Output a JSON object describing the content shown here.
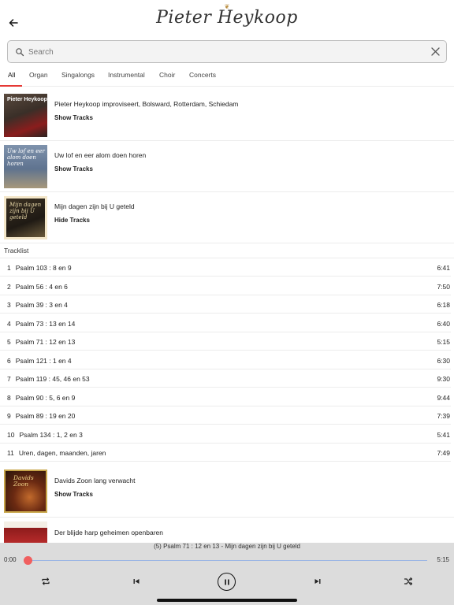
{
  "header": {
    "logo_text": "Pieter Heykoop",
    "back_icon": "arrow-left-icon"
  },
  "search": {
    "placeholder": "Search",
    "value": ""
  },
  "tabs": [
    {
      "label": "All",
      "active": true
    },
    {
      "label": "Organ",
      "active": false
    },
    {
      "label": "Singalongs",
      "active": false
    },
    {
      "label": "Instrumental",
      "active": false
    },
    {
      "label": "Choir",
      "active": false
    },
    {
      "label": "Concerts",
      "active": false
    }
  ],
  "albums": [
    {
      "title": "Pieter Heykoop improviseert, Bolsward, Rotterdam, Schiedam",
      "action": "Show Tracks",
      "cover_text": "Pieter Heykoop"
    },
    {
      "title": "Uw lof en eer alom doen horen",
      "action": "Show Tracks",
      "cover_text": "Uw lof en eer alom doen horen"
    },
    {
      "title": "Mijn dagen zijn bij U geteld",
      "action": "Hide Tracks",
      "cover_text": "Mijn dagen zijn bij U geteld"
    },
    {
      "title": "Davids Zoon lang verwacht",
      "action": "Show Tracks",
      "cover_text": "Davids Zoon"
    },
    {
      "title": "Der blijde harp geheimen openbaren",
      "action": "",
      "cover_text": ""
    }
  ],
  "tracklist": {
    "heading": "Tracklist",
    "tracks": [
      {
        "num": "1",
        "title": "Psalm 103 : 8 en 9",
        "duration": "6:41"
      },
      {
        "num": "2",
        "title": "Psalm 56 : 4 en 6",
        "duration": "7:50"
      },
      {
        "num": "3",
        "title": "Psalm 39 : 3 en 4",
        "duration": "6:18"
      },
      {
        "num": "4",
        "title": "Psalm 73 : 13 en 14",
        "duration": "6:40"
      },
      {
        "num": "5",
        "title": "Psalm 71 : 12 en 13",
        "duration": "5:15"
      },
      {
        "num": "6",
        "title": "Psalm 121 : 1 en 4",
        "duration": "6:30"
      },
      {
        "num": "7",
        "title": "Psalm 119 : 45, 46 en 53",
        "duration": "9:30"
      },
      {
        "num": "8",
        "title": "Psalm 90 : 5, 6 en 9",
        "duration": "9:44"
      },
      {
        "num": "9",
        "title": "Psalm 89 : 19 en 20",
        "duration": "7:39"
      },
      {
        "num": "10",
        "title": "Psalm 134 : 1, 2 en 3",
        "duration": "5:41"
      },
      {
        "num": "11",
        "title": "Uren, dagen, maanden, jaren",
        "duration": "7:49"
      }
    ]
  },
  "player": {
    "now_playing": "(5) Psalm 71 : 12 en 13 - Mijn dagen zijn bij U geteld",
    "elapsed": "0:00",
    "total": "5:15",
    "progress": 0,
    "accent_color": "#f05f5f",
    "controls": [
      "repeat-icon",
      "skip-previous-icon",
      "pause-icon",
      "skip-next-icon",
      "shuffle-icon"
    ]
  }
}
